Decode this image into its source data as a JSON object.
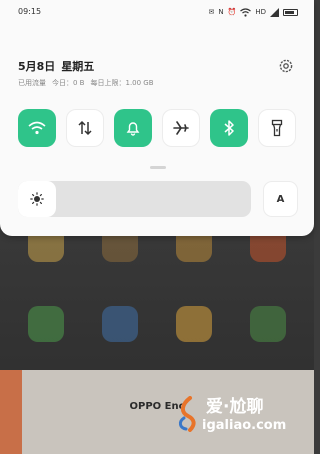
{
  "status_bar": {
    "time": "09:15",
    "icons": [
      "notification-icon",
      "nfc-icon",
      "alarm-icon",
      "wifi-icon",
      "hd-icon",
      "signal-icon",
      "battery-icon"
    ],
    "hd_label": "HD"
  },
  "header": {
    "date": "5月8日",
    "weekday": "星期五",
    "data_used": "已用流量",
    "today": "今日：0 B",
    "daily_limit": "每日上限：1.00 GB"
  },
  "quick_tiles": [
    {
      "name": "wifi",
      "icon": "wifi-icon",
      "state": "on"
    },
    {
      "name": "mobile-data",
      "icon": "data-arrows-icon",
      "state": "off"
    },
    {
      "name": "do-not-disturb",
      "icon": "bell-icon",
      "state": "on"
    },
    {
      "name": "airplane-mode",
      "icon": "airplane-icon",
      "state": "off"
    },
    {
      "name": "bluetooth",
      "icon": "bluetooth-icon",
      "state": "on"
    },
    {
      "name": "flashlight",
      "icon": "flashlight-icon",
      "state": "off"
    }
  ],
  "brightness": {
    "level": 0.12,
    "auto_label": "A"
  },
  "colors": {
    "accent": "#2fc48a",
    "shade_bg": "#fafafa"
  },
  "recent_app": {
    "title": "OPPO Enc"
  },
  "watermark": {
    "line1": "爱·尬聊",
    "line2": "igaliao.com"
  }
}
